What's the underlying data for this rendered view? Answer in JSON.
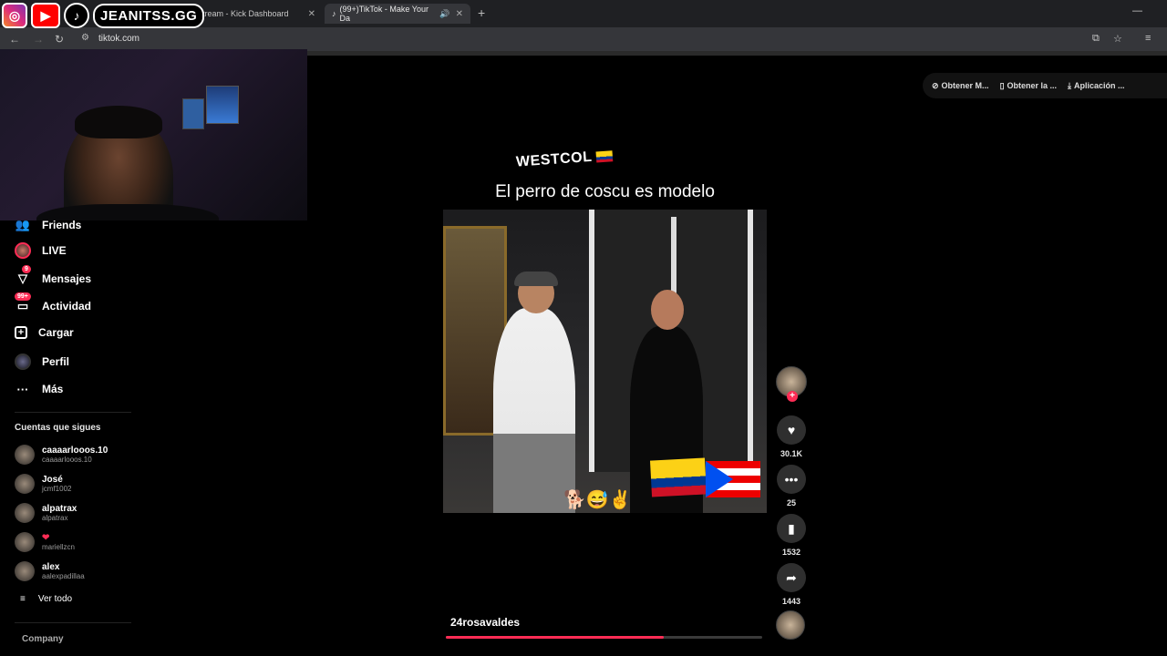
{
  "browser": {
    "tabs": [
      {
        "title": "Stream - Kick Dashboard",
        "active": false
      },
      {
        "title": "(99+)TikTok - Make Your Da",
        "active": true
      }
    ],
    "url": "tiktok.com"
  },
  "overlay": {
    "handle": "JEANITSS.GG"
  },
  "sidebar": {
    "nav": [
      {
        "label": "Friends",
        "icon": "friends-icon"
      },
      {
        "label": "LIVE",
        "icon": "live-avatar-icon"
      },
      {
        "label": "Mensajes",
        "icon": "messages-icon",
        "badge": "9"
      },
      {
        "label": "Actividad",
        "icon": "activity-icon",
        "badge": "99+"
      },
      {
        "label": "Cargar",
        "icon": "upload-icon"
      },
      {
        "label": "Perfil",
        "icon": "profile-avatar-icon"
      },
      {
        "label": "Más",
        "icon": "more-icon"
      }
    ],
    "following_title": "Cuentas que sigues",
    "following": [
      {
        "name": "caaaarlooos.10",
        "handle": "caaaarlooos.10"
      },
      {
        "name": "José",
        "handle": "jcmf1002"
      },
      {
        "name": "alpatrax",
        "handle": "alpatrax"
      },
      {
        "name": "❤",
        "handle": "mariellzcn"
      },
      {
        "name": "alex",
        "handle": "aalexpadillaa"
      }
    ],
    "see_all": "Ver todo",
    "company": "Company"
  },
  "toolbar": {
    "items": [
      {
        "label": "Obtener M...",
        "icon": "coin-icon"
      },
      {
        "label": "Obtener la ...",
        "icon": "phone-icon"
      },
      {
        "label": "Aplicación ...",
        "icon": "download-icon"
      }
    ]
  },
  "video": {
    "header": "WESTCOL",
    "caption": "El perro de coscu es modelo",
    "emojis": "🐕😅✌",
    "username": "24rosavaldes",
    "progress": 0.69
  },
  "actions": {
    "likes": "30.1K",
    "comments": "25",
    "saves": "1532",
    "shares": "1443"
  },
  "colors": {
    "accent": "#fe2c55",
    "background": "#000000"
  }
}
